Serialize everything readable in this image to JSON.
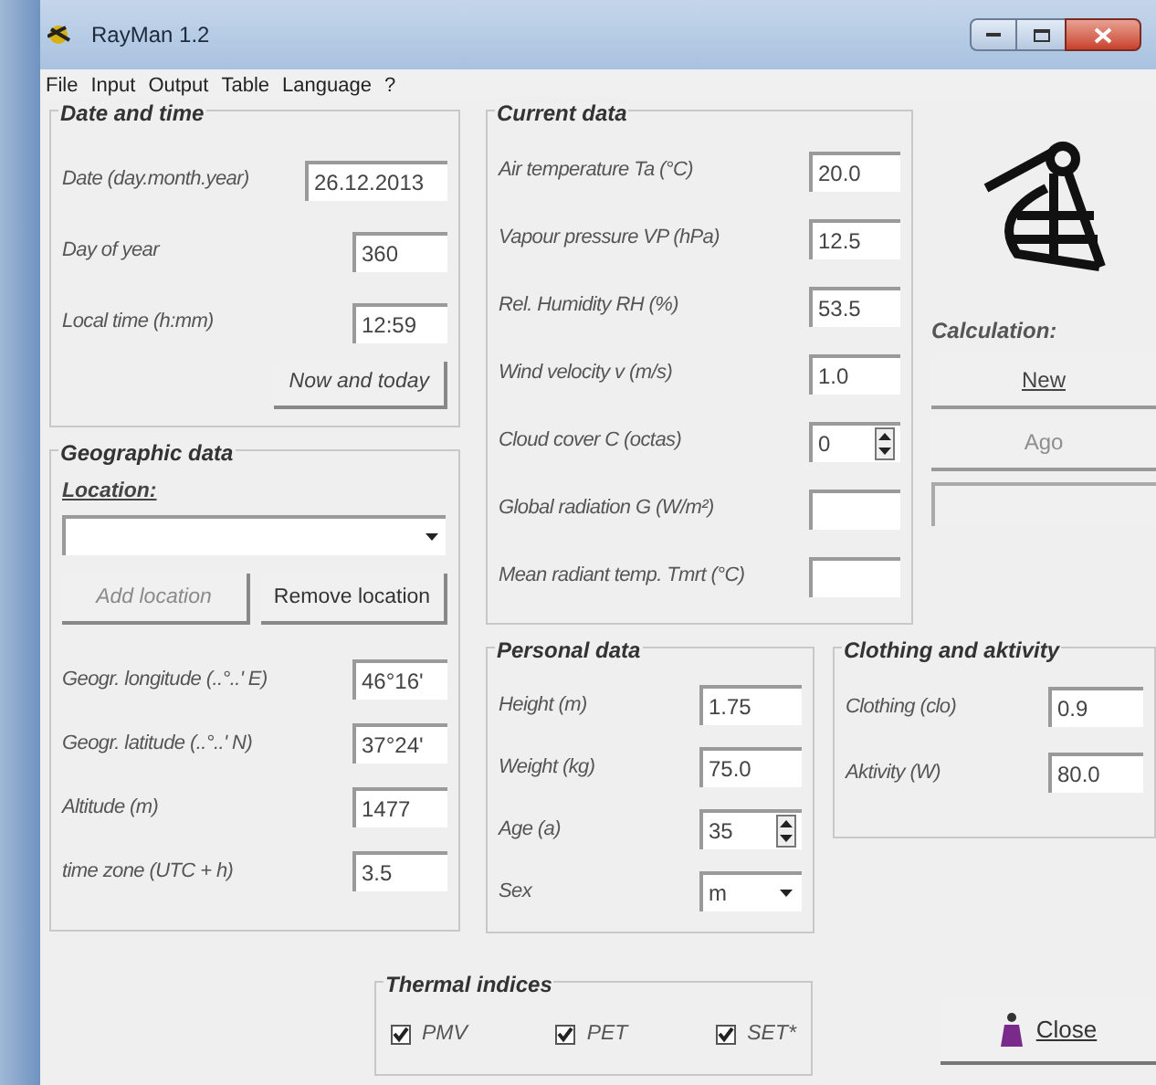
{
  "window": {
    "title": "RayMan 1.2"
  },
  "menu": [
    "File",
    "Input",
    "Output",
    "Table",
    "Language",
    "?"
  ],
  "date_and_time": {
    "title": "Date and time",
    "fields": [
      {
        "label": "Date (day.month.year)",
        "value": "26.12.2013"
      },
      {
        "label": "Day of year",
        "value": "360"
      },
      {
        "label": "Local time (h:mm)",
        "value": "12:59"
      }
    ],
    "button": "Now and today"
  },
  "geographic_data": {
    "title": "Geographic data",
    "location_label": "Location:",
    "buttons": [
      {
        "label": "Add location",
        "disabled": true
      },
      {
        "label": "Remove location",
        "disabled": false
      }
    ],
    "fields": [
      {
        "label": "Geogr. longitude (..°..' E)",
        "value": "46°16'"
      },
      {
        "label": "Geogr. latitude (..°..' N)",
        "value": "37°24'"
      },
      {
        "label": "Altitude (m)",
        "value": "1477"
      },
      {
        "label": "time zone (UTC + h)",
        "value": "3.5"
      }
    ]
  },
  "current_data": {
    "title": "Current data",
    "fields": [
      {
        "label": "Air temperature Ta (°C)",
        "value": "20.0",
        "kind": "text"
      },
      {
        "label": "Vapour pressure VP (hPa)",
        "value": "12.5",
        "kind": "text"
      },
      {
        "label": "Rel. Humidity RH (%)",
        "value": "53.5",
        "kind": "text"
      },
      {
        "label": "Wind velocity v (m/s)",
        "value": "1.0",
        "kind": "text"
      },
      {
        "label": "Cloud cover C (octas)",
        "value": "0",
        "kind": "spin"
      },
      {
        "label": "Global radiation G (W/m²)",
        "kind": "text"
      },
      {
        "label": "Mean radiant temp. Tmrt (°C)",
        "kind": "text"
      }
    ]
  },
  "calculation": {
    "label": "Calculation:",
    "buttons": [
      {
        "label": "New",
        "disabled": false
      },
      {
        "label": "Ago",
        "disabled": true
      }
    ]
  },
  "personal_data": {
    "title": "Personal data",
    "fields": [
      {
        "label": "Height (m)",
        "value": "1.75",
        "kind": "text"
      },
      {
        "label": "Weight (kg)",
        "value": "75.0",
        "kind": "text"
      },
      {
        "label": "Age (a)",
        "value": "35",
        "kind": "spin"
      },
      {
        "label": "Sex",
        "value": "m",
        "kind": "select"
      }
    ]
  },
  "clothing_and_activity": {
    "title": "Clothing and aktivity",
    "fields": [
      {
        "label": "Clothing (clo)",
        "value": "0.9"
      },
      {
        "label": "Aktivity (W)",
        "value": "80.0"
      }
    ]
  },
  "thermal_indices": {
    "title": "Thermal indices",
    "options": [
      {
        "label": "PMV",
        "checked": true
      },
      {
        "label": "PET",
        "checked": true
      },
      {
        "label": "SET*",
        "checked": true
      }
    ]
  },
  "close_button": "Close"
}
